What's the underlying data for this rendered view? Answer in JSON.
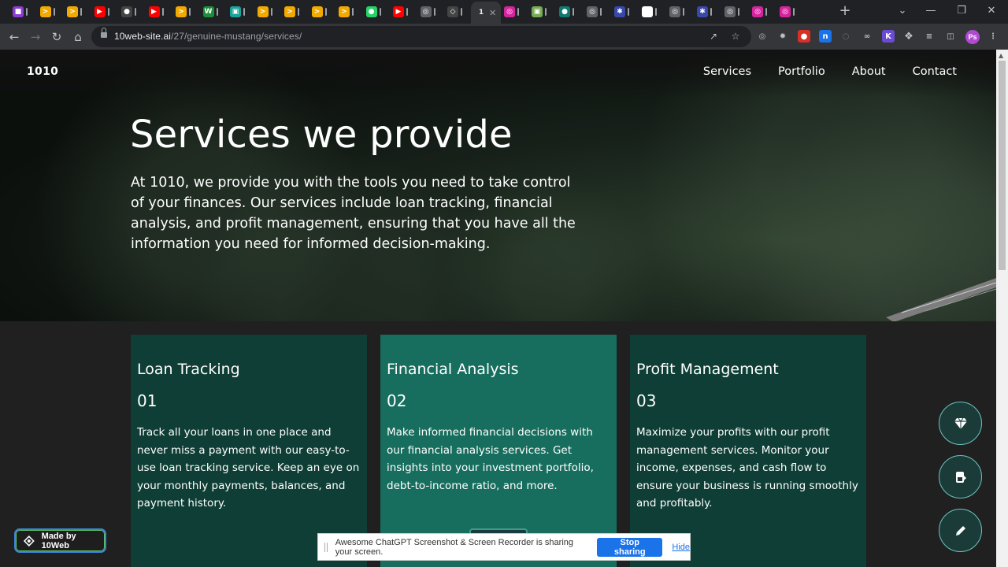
{
  "browser": {
    "tabs": [
      {
        "icon": "purple-app-icon",
        "color": "#8e3bd1",
        "glyph": "■"
      },
      {
        "icon": "orange-bolt-icon",
        "color": "#f2a900",
        "glyph": ">"
      },
      {
        "icon": "orange-bolt-icon",
        "color": "#f2a900",
        "glyph": ">"
      },
      {
        "icon": "youtube-icon",
        "color": "#ff0000",
        "glyph": "▶"
      },
      {
        "icon": "github-icon",
        "color": "#444444",
        "glyph": "●"
      },
      {
        "icon": "youtube-icon",
        "color": "#ff0000",
        "glyph": "▶"
      },
      {
        "icon": "orange-bolt-icon",
        "color": "#f2a900",
        "glyph": ">"
      },
      {
        "icon": "green-w-icon",
        "color": "#1b8f3a",
        "glyph": "W"
      },
      {
        "icon": "teal-square-icon",
        "color": "#1aa39a",
        "glyph": "▣"
      },
      {
        "icon": "orange-bolt-icon",
        "color": "#f2a900",
        "glyph": ">"
      },
      {
        "icon": "orange-bolt-icon",
        "color": "#f2a900",
        "glyph": ">"
      },
      {
        "icon": "orange-bolt-icon",
        "color": "#f2a900",
        "glyph": ">"
      },
      {
        "icon": "orange-bolt-icon",
        "color": "#f2a900",
        "glyph": ">"
      },
      {
        "icon": "whatsapp-icon",
        "color": "#25d366",
        "glyph": "●"
      },
      {
        "icon": "youtube-icon",
        "color": "#ff0000",
        "glyph": "▶"
      },
      {
        "icon": "chrome-icon",
        "color": "#5f6368",
        "glyph": "◎"
      },
      {
        "icon": "diamond-icon",
        "color": "#444444",
        "glyph": "◇"
      }
    ],
    "active_tab": {
      "label": "1",
      "close_glyph": "✕"
    },
    "tabs_right": [
      {
        "icon": "instagram-icon",
        "color": "#d6249f",
        "glyph": "◎"
      },
      {
        "icon": "photo-icon",
        "color": "#7a5",
        "glyph": "▣"
      },
      {
        "icon": "teal-circle-icon",
        "color": "#107a70",
        "glyph": "●"
      },
      {
        "icon": "chrome-icon",
        "color": "#5f6368",
        "glyph": "◎"
      },
      {
        "icon": "gear-blue-icon",
        "color": "#3949ab",
        "glyph": "✱"
      },
      {
        "icon": "google-icon",
        "color": "#ffffff",
        "glyph": "G"
      },
      {
        "icon": "chrome-icon",
        "color": "#5f6368",
        "glyph": "◎"
      },
      {
        "icon": "gear-blue-icon",
        "color": "#3949ab",
        "glyph": "✱"
      },
      {
        "icon": "chrome-icon",
        "color": "#5f6368",
        "glyph": "◎"
      },
      {
        "icon": "instagram-icon",
        "color": "#d6249f",
        "glyph": "◎"
      },
      {
        "icon": "instagram-icon",
        "color": "#d6249f",
        "glyph": "◎"
      }
    ],
    "new_tab_glyph": "+",
    "url": {
      "host": "10web-site.ai",
      "path": "/27/genuine-mustang/services/"
    },
    "profile_initials": "Ps"
  },
  "site": {
    "logo": "1010",
    "nav": [
      "Services",
      "Portfolio",
      "About",
      "Contact"
    ],
    "hero": {
      "title": "Services we provide",
      "text": "At 1010, we provide you with the tools you need to take control of your finances. Our services include loan tracking, financial analysis, and profit management, ensuring that you have all the information you need for informed decision-making."
    },
    "cards": [
      {
        "title": "Loan Tracking",
        "number": "01",
        "text": "Track all your loans in one place and never miss a payment with our easy-to-use loan tracking service. Keep an eye on your monthly payments, balances, and payment history."
      },
      {
        "title": "Financial Analysis",
        "number": "02",
        "text": "Make informed financial decisions with our financial analysis services. Get insights into your investment portfolio, debt-to-income ratio, and more."
      },
      {
        "title": "Profit Management",
        "number": "03",
        "text": "Maximize your profits with our profit management services. Monitor your income, expenses, and cash flow to ensure your business is running smoothly and profitably."
      }
    ],
    "made_by": "Made by 10Web"
  },
  "share_bar": {
    "text": "Awesome ChatGPT Screenshot & Screen Recorder is sharing your screen.",
    "stop_label": "Stop sharing",
    "hide_label": "Hide"
  },
  "colors": {
    "card_dark": "#0e3e35",
    "card_accent": "#176e5e",
    "fab_border": "#6bc3c0",
    "stop_button": "#1a73e8"
  }
}
